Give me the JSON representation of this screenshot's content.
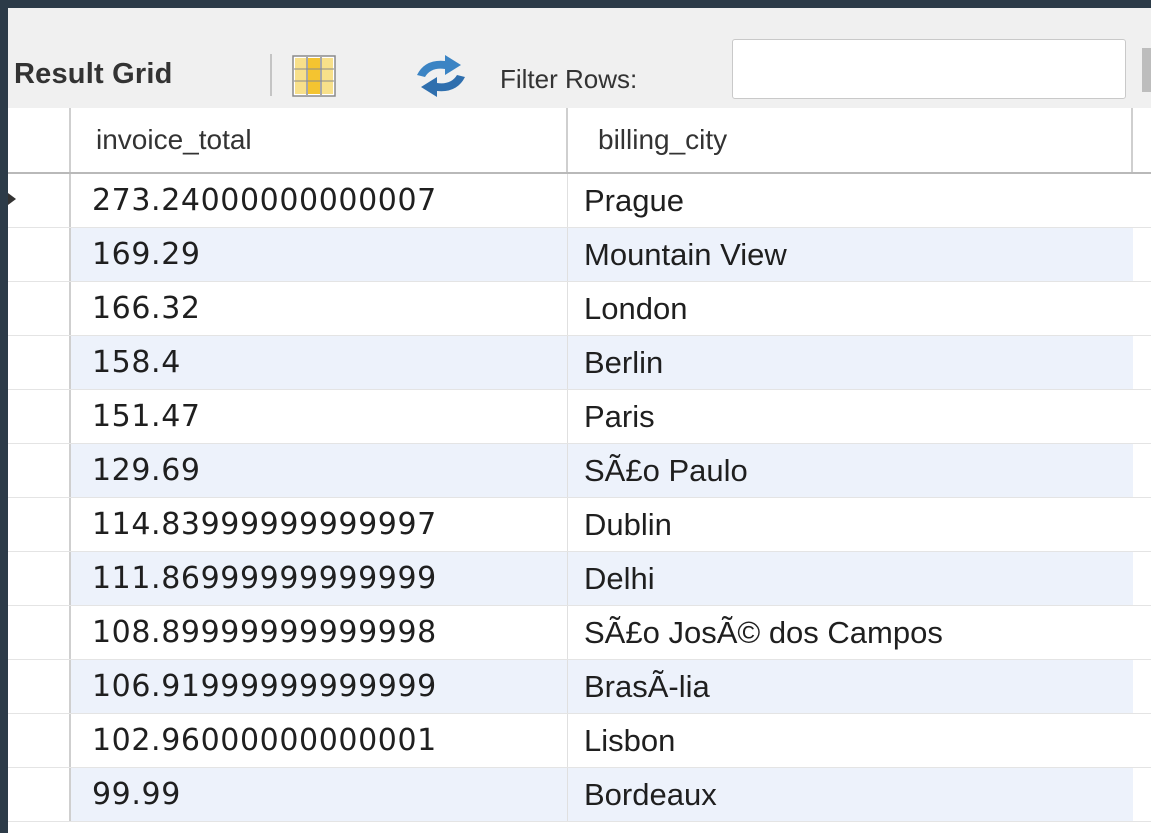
{
  "toolbar": {
    "result_grid_label": "Result Grid",
    "filter_label": "Filter Rows:",
    "filter_value": ""
  },
  "grid": {
    "columns": [
      "invoice_total",
      "billing_city"
    ],
    "rows": [
      {
        "invoice_total": "273.24000000000007",
        "billing_city": "Prague"
      },
      {
        "invoice_total": "169.29",
        "billing_city": "Mountain View"
      },
      {
        "invoice_total": "166.32",
        "billing_city": "London"
      },
      {
        "invoice_total": "158.4",
        "billing_city": "Berlin"
      },
      {
        "invoice_total": "151.47",
        "billing_city": "Paris"
      },
      {
        "invoice_total": "129.69",
        "billing_city": "SÃ£o Paulo"
      },
      {
        "invoice_total": "114.83999999999997",
        "billing_city": "Dublin"
      },
      {
        "invoice_total": "111.86999999999999",
        "billing_city": "Delhi"
      },
      {
        "invoice_total": "108.89999999999998",
        "billing_city": "SÃ£o JosÃ© dos Campos"
      },
      {
        "invoice_total": "106.91999999999999",
        "billing_city": "BrasÃ-lia"
      },
      {
        "invoice_total": "102.96000000000001",
        "billing_city": "Lisbon"
      },
      {
        "invoice_total": "99.99",
        "billing_city": "Bordeaux"
      }
    ]
  },
  "icons": {
    "grid_icon": "table-columns-icon",
    "refresh_icon": "refresh-icon"
  },
  "colors": {
    "page_border": "#2c3b48",
    "toolbar_bg": "#f0f0f0",
    "alt_row_bg": "#edf2fb",
    "refresh_icon": "#3b84c4",
    "grid_icon_fill": "#f4c430"
  }
}
